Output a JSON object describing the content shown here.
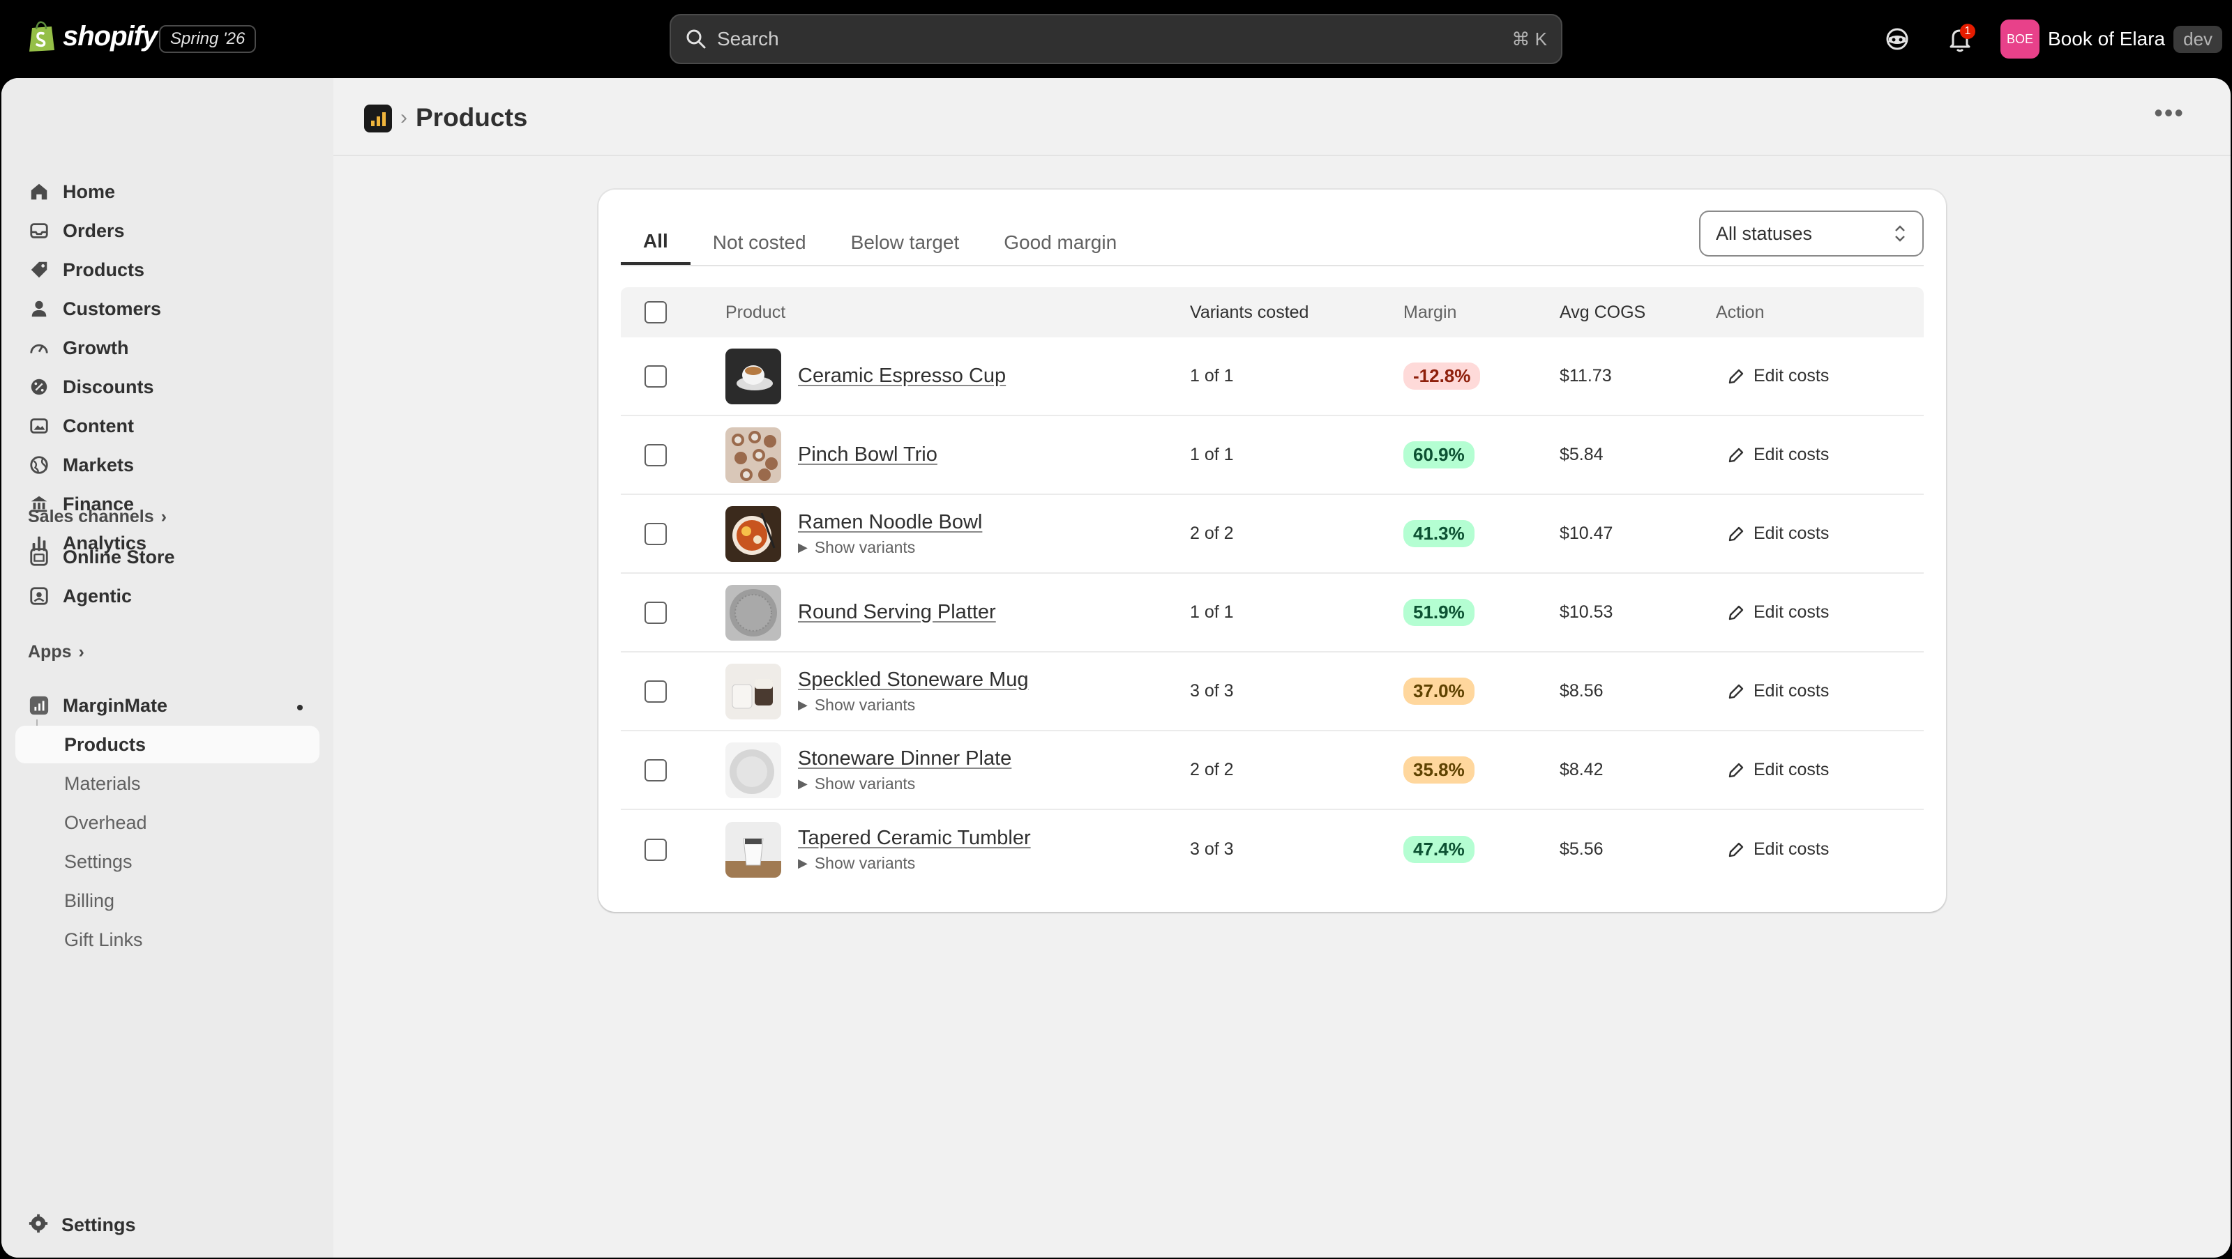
{
  "topbar": {
    "brand": "shopify",
    "edition": "Spring '26",
    "search_placeholder": "Search",
    "search_shortcut": "⌘  K",
    "notification_count": "1",
    "store_initials": "BOE",
    "store_name": "Book of Elara",
    "store_env": "dev"
  },
  "sidebar": {
    "items": [
      {
        "label": "Home",
        "icon": "home-icon"
      },
      {
        "label": "Orders",
        "icon": "inbox-icon"
      },
      {
        "label": "Products",
        "icon": "tag-icon"
      },
      {
        "label": "Customers",
        "icon": "person-icon"
      },
      {
        "label": "Growth",
        "icon": "gauge-icon"
      },
      {
        "label": "Discounts",
        "icon": "discount-icon"
      },
      {
        "label": "Content",
        "icon": "image-icon"
      },
      {
        "label": "Markets",
        "icon": "globe-icon"
      },
      {
        "label": "Finance",
        "icon": "bank-icon"
      },
      {
        "label": "Analytics",
        "icon": "bar-chart-icon"
      }
    ],
    "sales_channels_label": "Sales channels",
    "channels": [
      {
        "label": "Online Store",
        "icon": "store-icon"
      },
      {
        "label": "Agentic",
        "icon": "agentic-icon"
      }
    ],
    "apps_label": "Apps",
    "app_name": "MarginMate",
    "app_subitems": [
      "Products",
      "Materials",
      "Overhead",
      "Settings",
      "Billing",
      "Gift Links"
    ],
    "settings_label": "Settings"
  },
  "page": {
    "title": "Products",
    "breadcrumb_separator": "›",
    "more_label": "•••"
  },
  "tabs": [
    "All",
    "Not costed",
    "Below target",
    "Good margin"
  ],
  "status_filter": {
    "value": "All statuses"
  },
  "table": {
    "headers": {
      "product": "Product",
      "variants": "Variants costed",
      "margin": "Margin",
      "cogs": "Avg COGS",
      "action": "Action"
    },
    "show_variants_label": "Show variants",
    "edit_label": "Edit costs",
    "rows": [
      {
        "name": "Ceramic Espresso Cup",
        "variants": "1 of 1",
        "margin": "-12.8%",
        "margin_status": "red",
        "cogs": "$11.73",
        "has_variants": false
      },
      {
        "name": "Pinch Bowl Trio",
        "variants": "1 of 1",
        "margin": "60.9%",
        "margin_status": "green",
        "cogs": "$5.84",
        "has_variants": false
      },
      {
        "name": "Ramen Noodle Bowl",
        "variants": "2 of 2",
        "margin": "41.3%",
        "margin_status": "green",
        "cogs": "$10.47",
        "has_variants": true
      },
      {
        "name": "Round Serving Platter",
        "variants": "1 of 1",
        "margin": "51.9%",
        "margin_status": "green",
        "cogs": "$10.53",
        "has_variants": false
      },
      {
        "name": "Speckled Stoneware Mug",
        "variants": "3 of 3",
        "margin": "37.0%",
        "margin_status": "amber",
        "cogs": "$8.56",
        "has_variants": true
      },
      {
        "name": "Stoneware Dinner Plate",
        "variants": "2 of 2",
        "margin": "35.8%",
        "margin_status": "amber",
        "cogs": "$8.42",
        "has_variants": true
      },
      {
        "name": "Tapered Ceramic Tumbler",
        "variants": "3 of 3",
        "margin": "47.4%",
        "margin_status": "green",
        "cogs": "$5.56",
        "has_variants": true
      }
    ]
  },
  "colors": {
    "topbar": "#000000",
    "background": "#f1f1f1",
    "sidebar": "#ebebeb",
    "margin_red": "#fedad9",
    "margin_green": "#b4fed2",
    "margin_amber": "#ffd79d",
    "store_avatar": "#e8418a"
  }
}
